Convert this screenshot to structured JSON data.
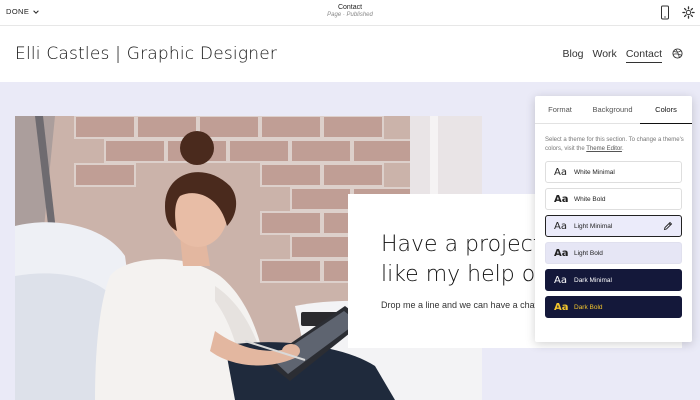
{
  "editor": {
    "done_label": "DONE",
    "page_title": "Contact",
    "page_status": "Page · Published"
  },
  "site": {
    "title": "Elli Castles | Graphic Designer",
    "nav": [
      "Blog",
      "Work",
      "Contact"
    ],
    "active_nav": "Contact"
  },
  "card": {
    "heading": "Have a project\nlike my help on it?",
    "text": "Drop me a line and we can have a chat about your project."
  },
  "panel": {
    "tabs": [
      "Format",
      "Background",
      "Colors"
    ],
    "active_tab": "Colors",
    "description_prefix": "Select a theme for this section. To change a theme's colors, visit the",
    "description_link": "Theme Editor",
    "description_suffix": ".",
    "themes": [
      {
        "aa": "Aa",
        "name": "White Minimal"
      },
      {
        "aa": "Aa",
        "name": "White Bold"
      },
      {
        "aa": "Aa",
        "name": "Light Minimal"
      },
      {
        "aa": "Aa",
        "name": "Light Bold"
      },
      {
        "aa": "Aa",
        "name": "Dark Minimal"
      },
      {
        "aa": "Aa",
        "name": "Dark Bold"
      }
    ],
    "selected_theme": "Light Minimal"
  },
  "colors": {
    "section_background": "#eaeaf7",
    "dark_theme": "#14183a",
    "accent_yellow": "#f2c42c"
  },
  "icons": [
    "chevron-down-icon",
    "mobile-icon",
    "gear-icon",
    "dribbble-icon",
    "pencil-icon"
  ]
}
